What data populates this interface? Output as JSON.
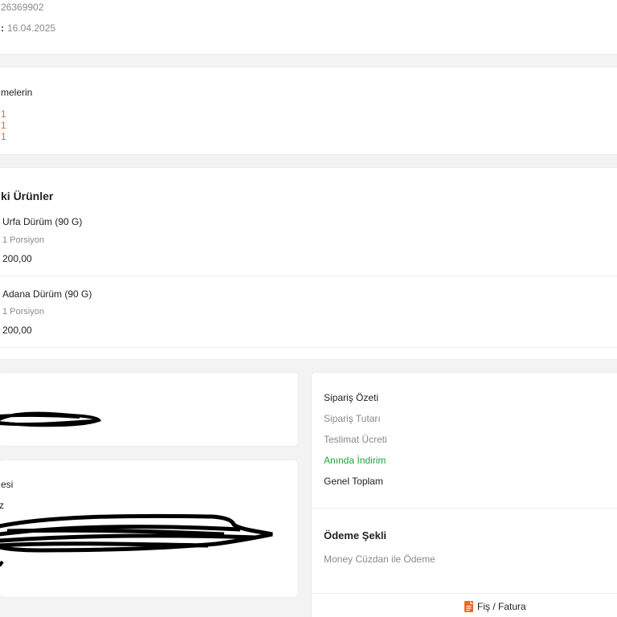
{
  "order_info": {
    "order_number_fragment": "26369902",
    "date_label_fragment": ":",
    "date_value": "16.04.2025"
  },
  "notes": {
    "title_fragment": "melerin",
    "lines": [
      "1",
      "1",
      "1"
    ]
  },
  "products": {
    "title_fragment": "ki Ürünler",
    "items": [
      {
        "name": "Urfa Dürüm (90 G)",
        "qty": "1 Porsiyon",
        "price": "200,00"
      },
      {
        "name": "Adana Dürüm (90 G)",
        "qty": "1 Porsiyon",
        "price": "200,00"
      }
    ]
  },
  "address": {
    "title_fragment": "esi",
    "line_fragment": "z"
  },
  "order_summary": {
    "title": "Sipariş Özeti",
    "order_amount_label": "Sipariş Tutarı",
    "delivery_fee_label": "Teslimat Ücreti",
    "instant_discount_label": "Anında İndirim",
    "grand_total_label": "Genel Toplam"
  },
  "payment": {
    "title": "Ödeme Şekli",
    "method": "Money Cüzdan ile Ödeme"
  },
  "receipt": {
    "label": "Fiş / Fatura",
    "icon": "document-icon"
  },
  "colors": {
    "accent": "#f26522",
    "discount": "#1fa33a"
  }
}
